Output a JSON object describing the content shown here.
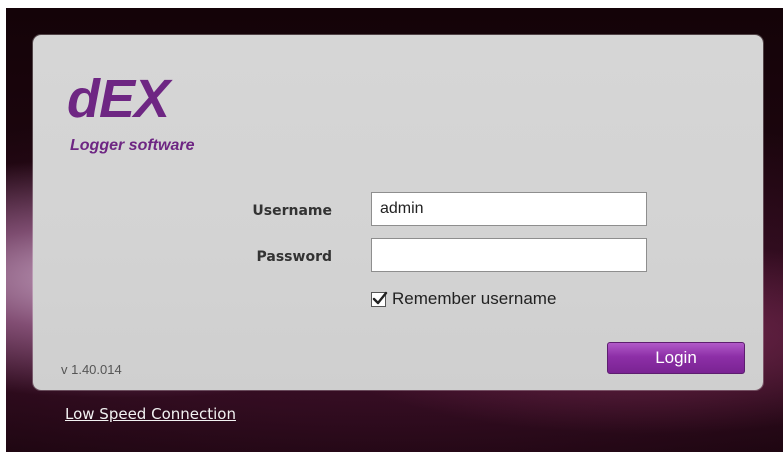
{
  "logo": {
    "title": "dEX",
    "tagline": "Logger software"
  },
  "form": {
    "username_label": "Username",
    "username_value": "admin",
    "password_label": "Password",
    "password_value": "",
    "remember_label": "Remember username",
    "remember_checked": true,
    "login_label": "Login"
  },
  "footer": {
    "version": "v 1.40.014",
    "low_speed_link": "Low Speed Connection"
  },
  "colors": {
    "brand_purple": "#6e2683",
    "button_purple": "#8d2fa7",
    "panel_gray": "#d4d4d4"
  }
}
